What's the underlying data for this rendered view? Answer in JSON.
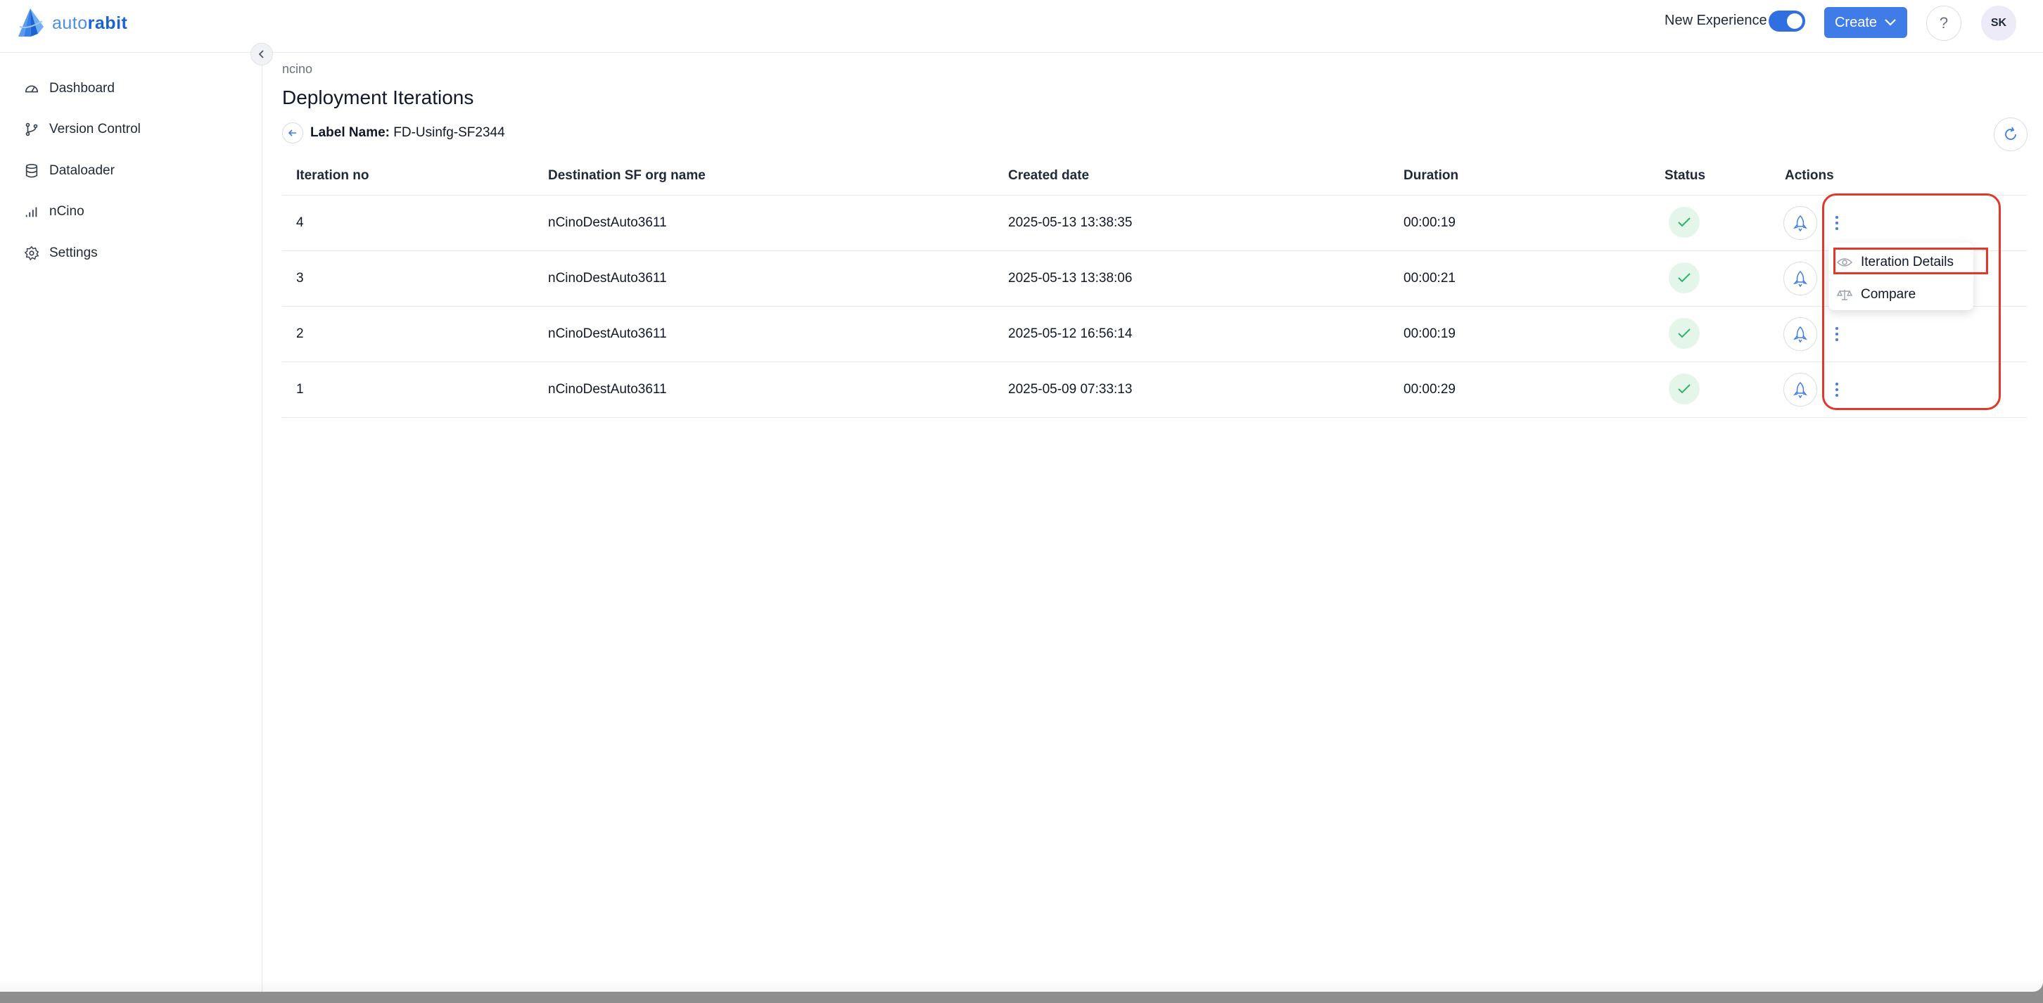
{
  "app": {
    "logo_text_light": "auto",
    "logo_text_bold": "rabit"
  },
  "header": {
    "new_experience_label": "New Experience",
    "new_experience_on": true,
    "create_label": "Create",
    "help_label": "?",
    "avatar_initials": "SK"
  },
  "sidebar": {
    "items": [
      {
        "label": "Dashboard",
        "icon": "dashboard-icon"
      },
      {
        "label": "Version Control",
        "icon": "branch-icon"
      },
      {
        "label": "Dataloader",
        "icon": "database-icon"
      },
      {
        "label": "nCino",
        "icon": "signal-bars-icon"
      },
      {
        "label": "Settings",
        "icon": "gear-icon"
      }
    ]
  },
  "page": {
    "breadcrumb": "ncino",
    "title": "Deployment Iterations",
    "label_key": "Label Name:",
    "label_value": "FD-Usinfg-SF2344"
  },
  "table": {
    "columns": [
      "Iteration no",
      "Destination SF org name",
      "Created date",
      "Duration",
      "Status",
      "Actions"
    ],
    "rows": [
      {
        "iteration": "4",
        "org": "nCinoDestAuto3611",
        "created": "2025-05-13 13:38:35",
        "duration": "00:00:19",
        "status": "success"
      },
      {
        "iteration": "3",
        "org": "nCinoDestAuto3611",
        "created": "2025-05-13 13:38:06",
        "duration": "00:00:21",
        "status": "success"
      },
      {
        "iteration": "2",
        "org": "nCinoDestAuto3611",
        "created": "2025-05-12 16:56:14",
        "duration": "00:00:19",
        "status": "success"
      },
      {
        "iteration": "1",
        "org": "nCinoDestAuto3611",
        "created": "2025-05-09 07:33:13",
        "duration": "00:00:29",
        "status": "success"
      }
    ]
  },
  "dropdown": {
    "items": [
      {
        "label": "Iteration Details",
        "icon": "eye-icon"
      },
      {
        "label": "Compare",
        "icon": "scale-icon"
      }
    ]
  },
  "colors": {
    "accent": "#3f7ce8",
    "success": "#2fb36a",
    "highlight": "#e0392b"
  }
}
